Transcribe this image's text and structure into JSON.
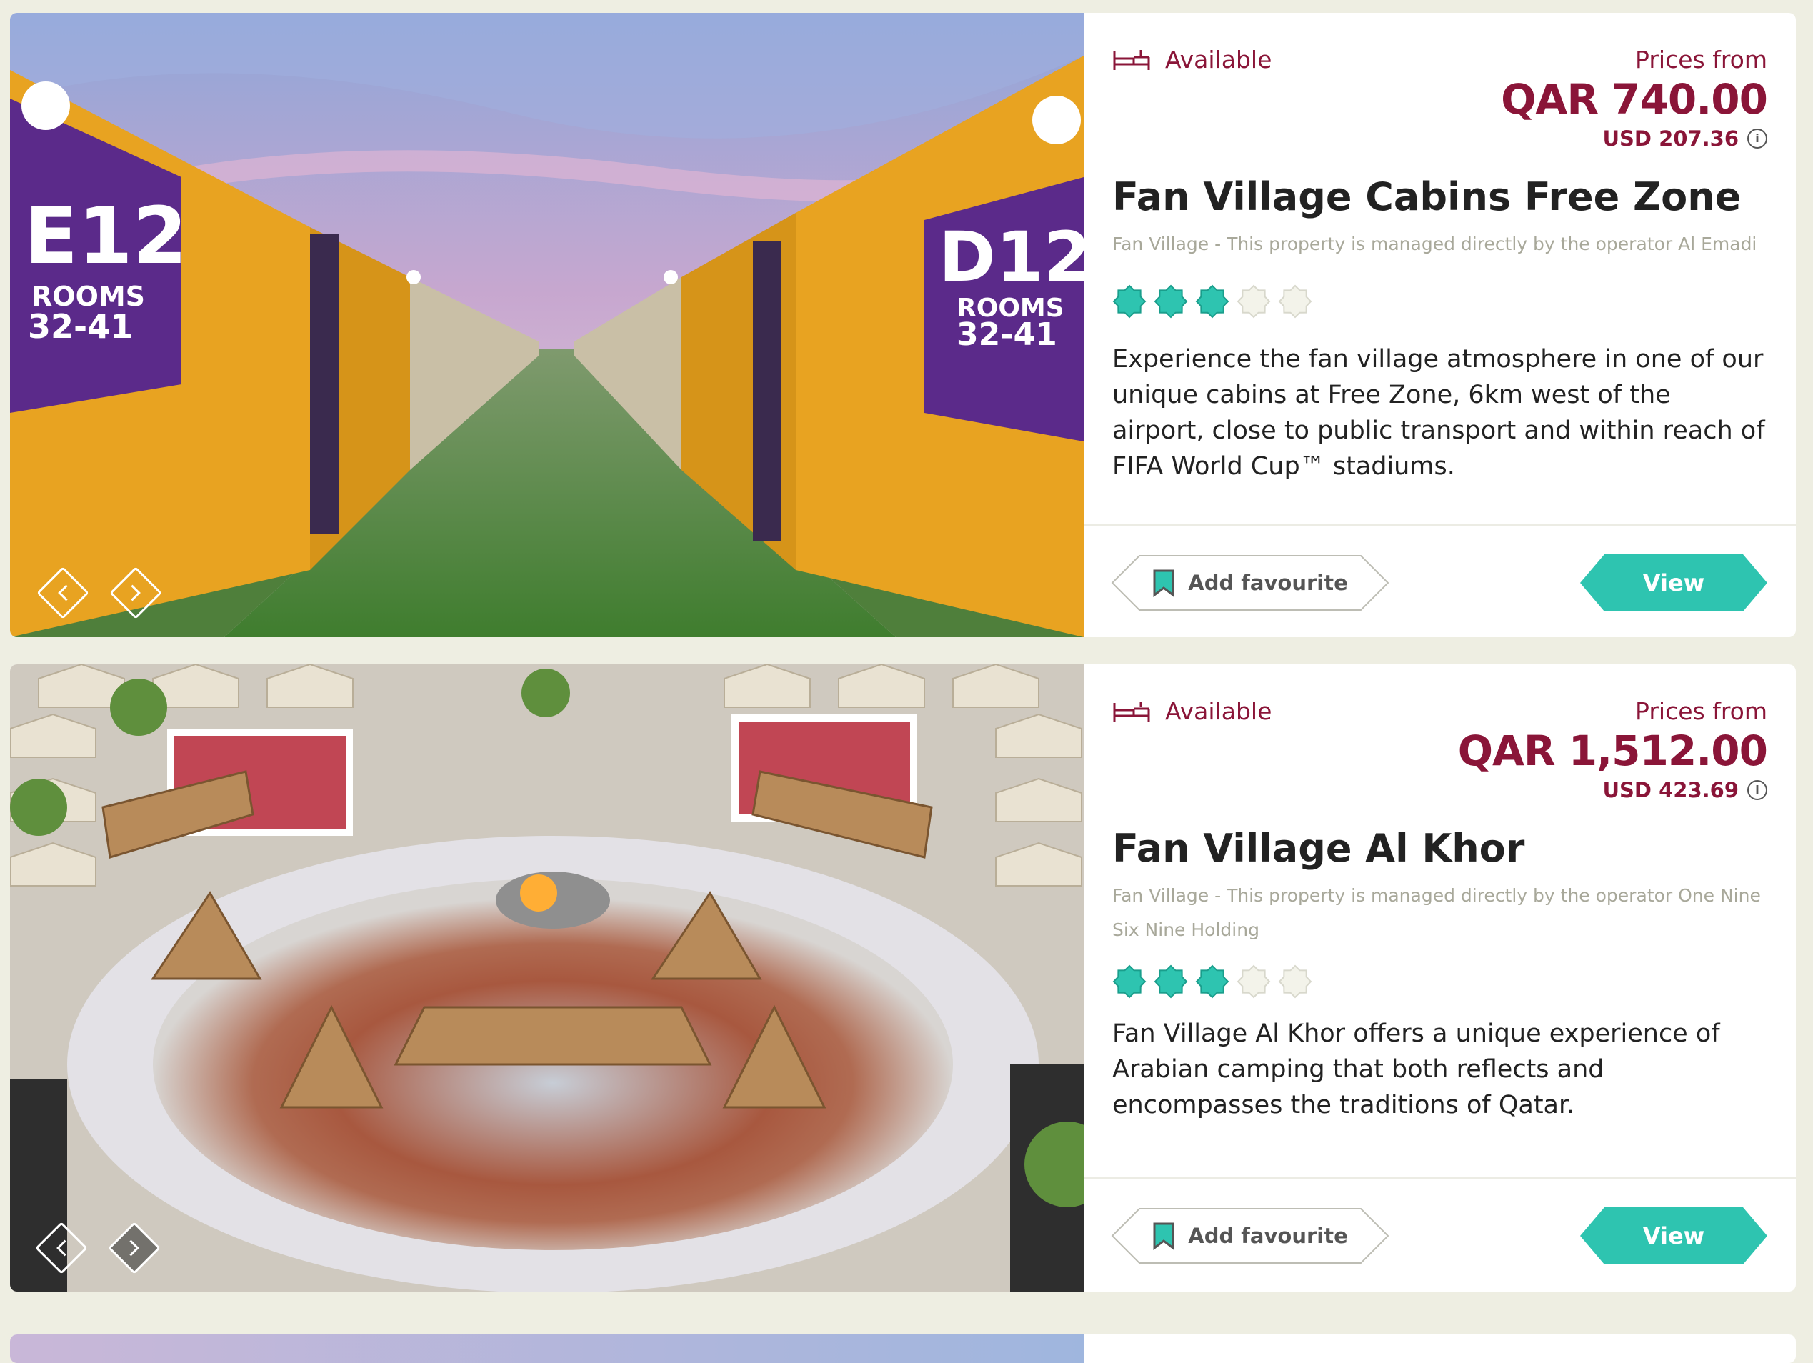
{
  "listings": [
    {
      "image_alt": "",
      "status": "Available",
      "status_icon": "bed-icon",
      "prices_from_label": "Prices from",
      "price_qar": "QAR 740.00",
      "price_usd": "USD 207.36",
      "title": "Fan Village Cabins Free Zone",
      "subtitle": "Fan Village - This property is managed directly by the operator Al Emadi",
      "rating": 3,
      "rating_max": 5,
      "description": "Experience the fan village atmosphere in one of our unique cabins at Free Zone, 6km west of the airport, close to public transport and within reach of FIFA World Cup™ stadiums.",
      "favourite_label": "Add favourite",
      "view_label": "View"
    },
    {
      "image_alt": "",
      "status": "Available",
      "status_icon": "bed-icon",
      "prices_from_label": "Prices from",
      "price_qar": "QAR 1,512.00",
      "price_usd": "USD 423.69",
      "title": "Fan Village Al Khor",
      "subtitle": "Fan Village - This property is managed directly by the operator One Nine Six Nine Holding",
      "rating": 3,
      "rating_max": 5,
      "description": "Fan Village Al Khor offers a unique experience of Arabian camping that both reflects and encompasses the traditions of Qatar.",
      "favourite_label": "Add favourite",
      "view_label": "View"
    }
  ],
  "colors": {
    "accent": "#8a1538",
    "teal": "#2ec4b0",
    "page_bg": "#eeeee2"
  }
}
